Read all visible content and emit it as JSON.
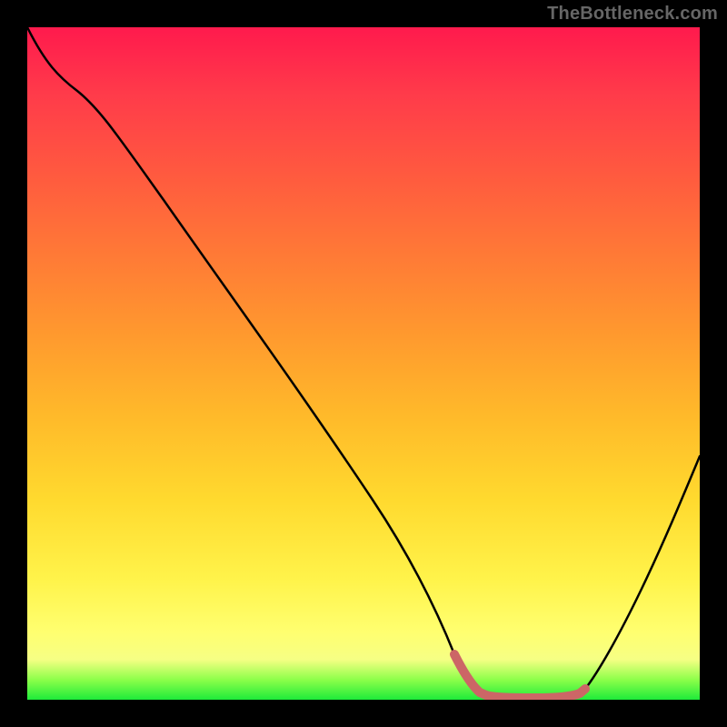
{
  "watermark": "TheBottleneck.com",
  "chart_data": {
    "type": "line",
    "title": "",
    "xlabel": "",
    "ylabel": "",
    "x": [
      0,
      5,
      10,
      15,
      20,
      25,
      30,
      35,
      40,
      45,
      50,
      55,
      60,
      63,
      66,
      70,
      74,
      78,
      82,
      86,
      90,
      95,
      100
    ],
    "values": [
      100,
      94,
      88,
      80,
      72,
      64,
      56,
      48,
      40,
      32,
      24,
      16,
      8,
      3,
      1,
      0,
      0,
      0,
      1,
      4,
      10,
      20,
      35
    ],
    "xlim": [
      0,
      100
    ],
    "ylim": [
      0,
      100
    ],
    "curve_color": "#000000",
    "valley_color": "#cc6666",
    "valley_range_x": [
      62,
      83
    ],
    "gradient_stops": [
      {
        "pos": 0,
        "color": "#ff1a4d"
      },
      {
        "pos": 50,
        "color": "#ffa030"
      },
      {
        "pos": 85,
        "color": "#ffff70"
      },
      {
        "pos": 100,
        "color": "#1eeb3a"
      }
    ]
  }
}
